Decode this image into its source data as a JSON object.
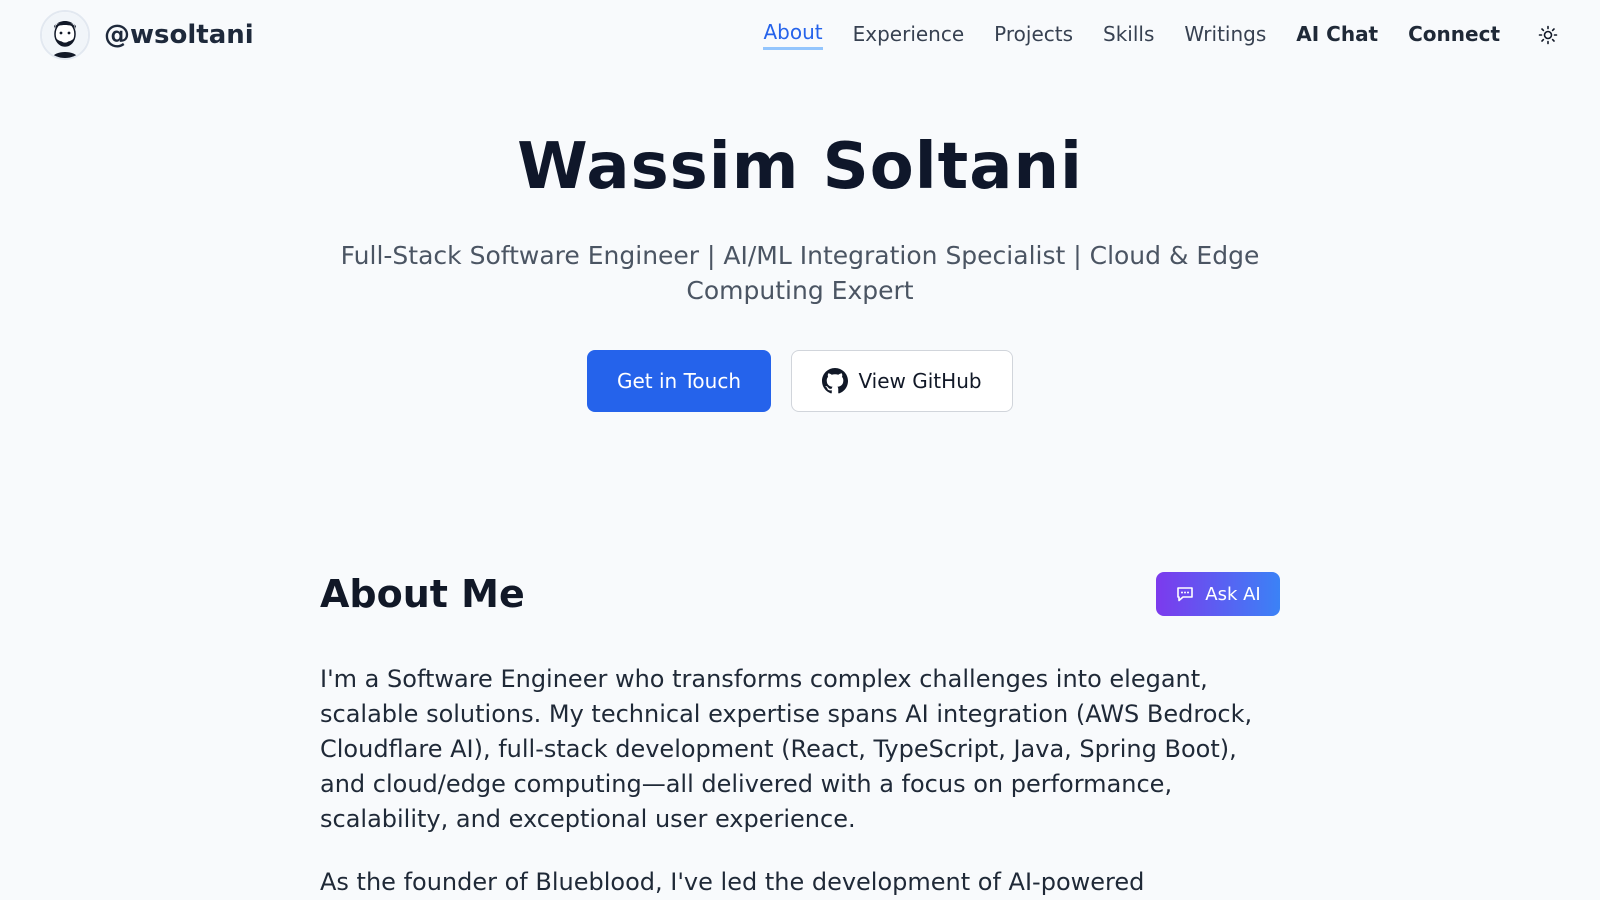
{
  "header": {
    "handle": "@wsoltani",
    "nav": [
      {
        "label": "About"
      },
      {
        "label": "Experience"
      },
      {
        "label": "Projects"
      },
      {
        "label": "Skills"
      },
      {
        "label": "Writings"
      },
      {
        "label": "AI Chat"
      },
      {
        "label": "Connect"
      }
    ],
    "active_nav": "About",
    "theme_icon": "sun-icon"
  },
  "hero": {
    "name": "Wassim Soltani",
    "tagline": "Full-Stack Software Engineer | AI/ML Integration Specialist | Cloud & Edge Computing Expert",
    "primary_button": "Get in Touch",
    "secondary_button": "View GitHub",
    "secondary_icon": "github-icon"
  },
  "about": {
    "title": "About Me",
    "ask_ai_label": "Ask AI",
    "ask_ai_icon": "chat-bubble-icon",
    "paragraphs": [
      "I'm a Software Engineer who transforms complex challenges into elegant, scalable solutions. My technical expertise spans AI integration (AWS Bedrock, Cloudflare AI), full-stack development (React, TypeScript, Java, Spring Boot), and cloud/edge computing—all delivered with a focus on performance, scalability, and exceptional user experience.",
      "As the founder of Blueblood, I've led the development of AI-powered"
    ]
  },
  "colors": {
    "background": "#f8fafc",
    "accent": "#2563eb",
    "ask_ai_gradient_start": "#7c3aed",
    "ask_ai_gradient_end": "#3b82f6"
  }
}
